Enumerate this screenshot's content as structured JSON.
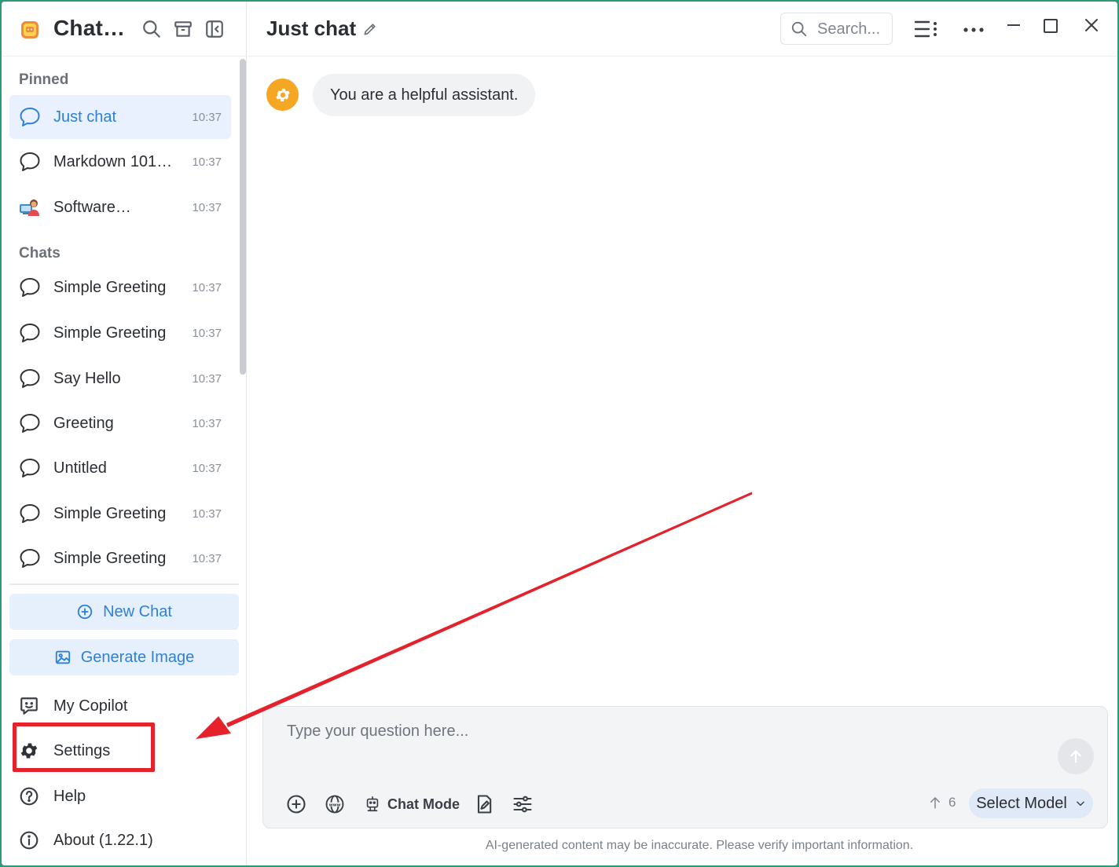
{
  "app": {
    "title": "Chat…"
  },
  "sidebar": {
    "pinned_label": "Pinned",
    "pinned": [
      {
        "label": "Just chat",
        "time": "10:37",
        "active": true,
        "icon": "chat-bubble-icon"
      },
      {
        "label": "Markdown 101…",
        "time": "10:37",
        "icon": "chat-bubble-icon"
      },
      {
        "label": "Software…",
        "time": "10:37",
        "icon": "developer-avatar-icon"
      }
    ],
    "chats_label": "Chats",
    "chats": [
      {
        "label": "Simple Greeting",
        "time": "10:37"
      },
      {
        "label": "Simple Greeting",
        "time": "10:37"
      },
      {
        "label": "Say Hello",
        "time": "10:37"
      },
      {
        "label": "Greeting",
        "time": "10:37"
      },
      {
        "label": "Untitled",
        "time": "10:37"
      },
      {
        "label": "Simple Greeting",
        "time": "10:37"
      },
      {
        "label": "Simple Greeting",
        "time": "10:37"
      }
    ],
    "new_chat": "New Chat",
    "generate_image": "Generate Image",
    "footer": [
      {
        "label": "My Copilot",
        "icon": "copilot-icon"
      },
      {
        "label": "Settings",
        "icon": "gear-icon"
      },
      {
        "label": "Help",
        "icon": "help-icon"
      },
      {
        "label": "About (1.22.1)",
        "icon": "info-icon"
      }
    ]
  },
  "main": {
    "title": "Just chat",
    "search_placeholder": "Search...",
    "system_message": "You are a helpful assistant.",
    "composer": {
      "placeholder": "Type your question here...",
      "chat_mode": "Chat Mode",
      "token_count": "6",
      "select_model": "Select Model"
    },
    "disclaimer": "AI-generated content may be inaccurate. Please verify important information."
  },
  "colors": {
    "accent": "#2f80d6",
    "highlight": "#e5212b",
    "system_avatar": "#f5a623"
  }
}
